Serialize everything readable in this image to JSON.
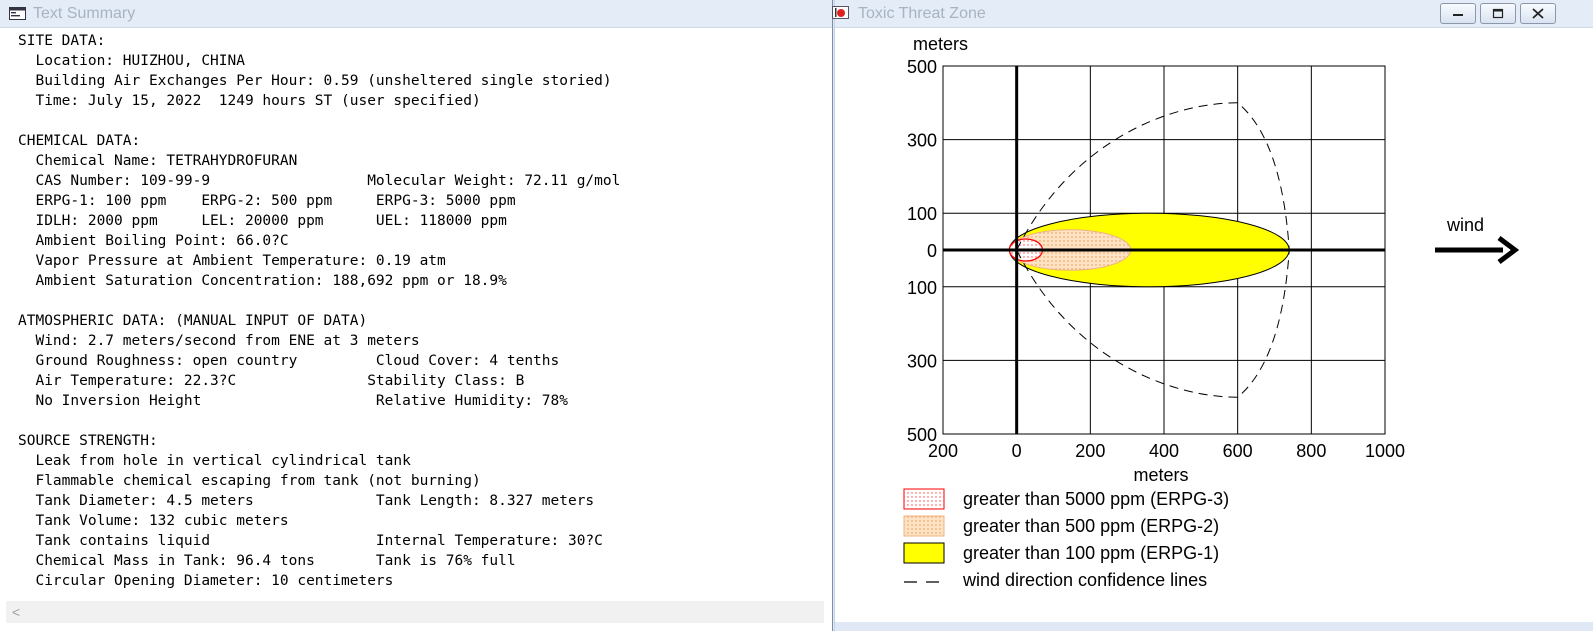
{
  "left_window": {
    "title": "Text Summary",
    "lines": [
      "SITE DATA:",
      "  Location: HUIZHOU, CHINA",
      "  Building Air Exchanges Per Hour: 0.59 (unsheltered single storied)",
      "  Time: July 15, 2022  1249 hours ST (user specified)",
      "",
      "CHEMICAL DATA:",
      "  Chemical Name: TETRAHYDROFURAN",
      "  CAS Number: 109-99-9                  Molecular Weight: 72.11 g/mol",
      "  ERPG-1: 100 ppm    ERPG-2: 500 ppm     ERPG-3: 5000 ppm",
      "  IDLH: 2000 ppm     LEL: 20000 ppm      UEL: 118000 ppm",
      "  Ambient Boiling Point: 66.0?C",
      "  Vapor Pressure at Ambient Temperature: 0.19 atm",
      "  Ambient Saturation Concentration: 188,692 ppm or 18.9%",
      "",
      "ATMOSPHERIC DATA: (MANUAL INPUT OF DATA)",
      "  Wind: 2.7 meters/second from ENE at 3 meters",
      "  Ground Roughness: open country         Cloud Cover: 4 tenths",
      "  Air Temperature: 22.3?C               Stability Class: B",
      "  No Inversion Height                    Relative Humidity: 78%",
      "",
      "SOURCE STRENGTH:",
      "  Leak from hole in vertical cylindrical tank",
      "  Flammable chemical escaping from tank (not burning)",
      "  Tank Diameter: 4.5 meters              Tank Length: 8.327 meters",
      "  Tank Volume: 132 cubic meters",
      "  Tank contains liquid                   Internal Temperature: 30?C",
      "  Chemical Mass in Tank: 96.4 tons       Tank is 76% full",
      "  Circular Opening Diameter: 10 centimeters"
    ],
    "scroll_left_glyph": "<"
  },
  "right_window": {
    "title": "Toxic Threat Zone",
    "buttons": [
      "minimize",
      "maximize",
      "close"
    ]
  },
  "colors": {
    "erpg1_fill": "#ffff00",
    "erpg2_fill": "#fbd6b0",
    "erpg3_outline": "#ff0000",
    "grid": "#000000"
  },
  "chart_data": {
    "type": "area",
    "xlabel": "meters",
    "ylabel": "meters",
    "xlim": [
      -200,
      1000
    ],
    "ylim": [
      -500,
      500
    ],
    "x_ticks": [
      "200",
      "0",
      "200",
      "400",
      "600",
      "800",
      "1000"
    ],
    "y_ticks": [
      "500",
      "300",
      "100",
      "0",
      "100",
      "300",
      "500"
    ],
    "grid": true,
    "wind_label": "wind",
    "zones": [
      {
        "name": "greater than 5000 ppm (ERPG-3)",
        "x_min": -20,
        "x_max": 70,
        "half_width": 30
      },
      {
        "name": "greater than 500 ppm (ERPG-2)",
        "x_min": -20,
        "x_max": 310,
        "half_width": 55
      },
      {
        "name": "greater than 100 ppm (ERPG-1)",
        "x_min": -20,
        "x_max": 740,
        "half_width": 100
      }
    ],
    "confidence_lines": {
      "name": "wind direction confidence lines",
      "tip_x": 600,
      "tip_y": 400,
      "max_x": 740
    },
    "legend": [
      {
        "label": "greater than 5000 ppm (ERPG-3)",
        "style": "erpg3"
      },
      {
        "label": "greater than 500 ppm (ERPG-2)",
        "style": "erpg2"
      },
      {
        "label": "greater than 100 ppm (ERPG-1)",
        "style": "erpg1"
      },
      {
        "label": "wind direction confidence lines",
        "style": "dash"
      }
    ]
  }
}
